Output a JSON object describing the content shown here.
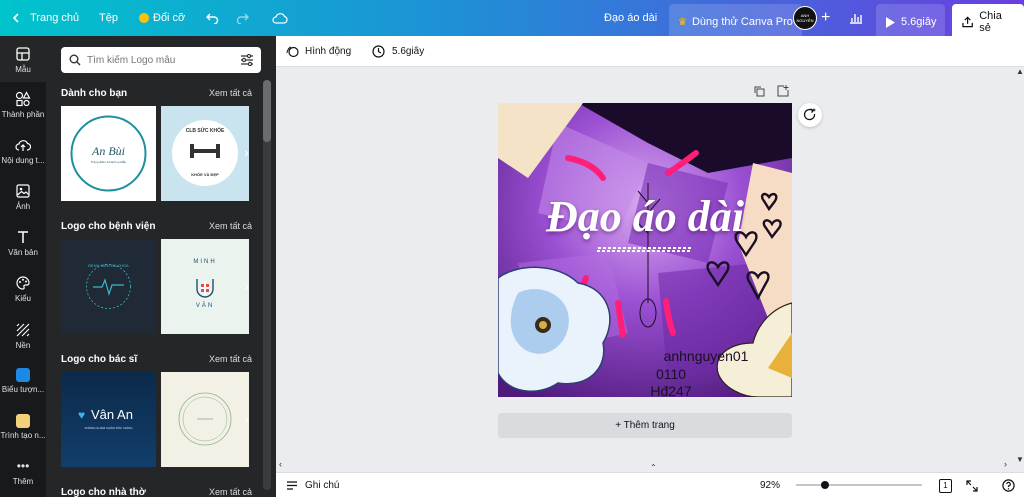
{
  "topbar": {
    "back_label": "Trang chủ",
    "file_label": "Tệp",
    "resize_label": "Đổi cỡ",
    "title": "Đạo áo dài",
    "pro_label": "Dùng thử Canva Pro",
    "avatar_text": "ANH NGUYÊN",
    "play_label": "5.6giây",
    "share_label": "Chia sẻ"
  },
  "rail": {
    "items": [
      {
        "label": "Mẫu",
        "icon": "template-icon"
      },
      {
        "label": "Thành phần",
        "icon": "elements-icon"
      },
      {
        "label": "Nội dung t...",
        "icon": "upload-icon"
      },
      {
        "label": "Ảnh",
        "icon": "photo-icon"
      },
      {
        "label": "Văn bản",
        "icon": "text-icon"
      },
      {
        "label": "Kiểu",
        "icon": "styles-icon"
      },
      {
        "label": "Nền",
        "icon": "background-icon"
      },
      {
        "label": "Biểu tượn...",
        "icon": "logo-app-icon"
      },
      {
        "label": "Trình tạo n...",
        "icon": "app-icon"
      },
      {
        "label": "Thêm",
        "icon": "more-icon"
      }
    ]
  },
  "panel": {
    "search_placeholder": "Tìm kiếm Logo mẫu",
    "see_all": "Xem tất cả",
    "sections": [
      {
        "title": "Dành cho bạn"
      },
      {
        "title": "Logo cho bệnh viện"
      },
      {
        "title": "Logo cho bác sĩ"
      },
      {
        "title": "Logo cho nhà thờ"
      }
    ],
    "thumbs": {
      "t1_title": "An Bùi",
      "t1_sub": "Trang điểm & Dịch vụ Mẫu",
      "t2_top": "CLB SỨC KHỎE",
      "t2_bottom": "KHỎE VÀ ĐẸP",
      "t3_text": "BỆNH VIỆN ĐA KHOA",
      "t4_top": "MINH",
      "t4_bottom": "VĂN",
      "t5_title": "Vân An",
      "t5_sub": "PHÒNG KHÁM CHĂM SÓC CHÍNH"
    }
  },
  "toolbar": {
    "animate_label": "Hình động",
    "duration_label": "5.6giây"
  },
  "design": {
    "title": "Đạo áo dài",
    "line1": "anhnguyen01",
    "line2": "0110",
    "line3": "Hđ247"
  },
  "canvas": {
    "add_page_label": "+ Thêm trang"
  },
  "bottombar": {
    "notes_label": "Ghi chú",
    "zoom": "92%",
    "zoom_fraction": 0.23,
    "page_count": "1"
  },
  "colors": {
    "accent": "#7d2ae8",
    "rail_bg": "#18191b",
    "panel_bg": "#252627",
    "pink": "#ff1e78"
  }
}
